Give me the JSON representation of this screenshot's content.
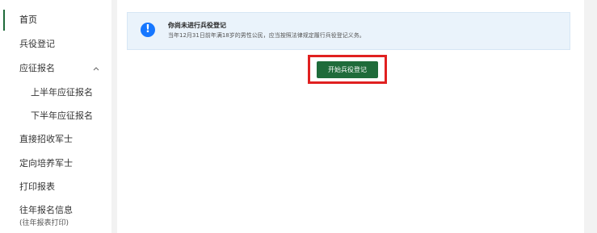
{
  "sidebar": {
    "items": [
      {
        "label": "首页"
      },
      {
        "label": "兵役登记"
      },
      {
        "label": "应征报名"
      },
      {
        "label": "上半年应征报名"
      },
      {
        "label": "下半年应征报名"
      },
      {
        "label": "直接招收军士"
      },
      {
        "label": "定向培养军士"
      },
      {
        "label": "打印报表"
      },
      {
        "label": "往年报名信息",
        "note": "(往年报表打印)"
      }
    ]
  },
  "alert": {
    "icon": "exclamation-icon",
    "title": "你尚未进行兵役登记",
    "description": "当年12月31日前年满18岁的男性公民，应当按照法律规定履行兵役登记义务。"
  },
  "cta": {
    "label": "开始兵役登记"
  },
  "colors": {
    "primary": "#1f6b3a",
    "alert_bg": "#eaf3fb",
    "alert_icon": "#1677ff",
    "highlight_border": "#e02020"
  }
}
